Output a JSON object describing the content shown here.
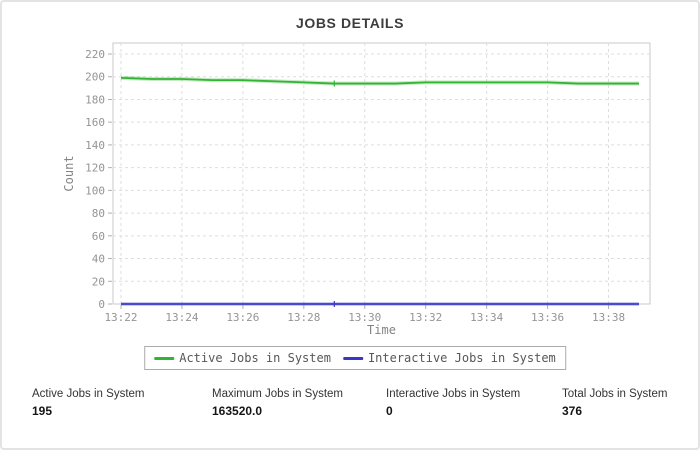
{
  "chart_data": {
    "type": "line",
    "title": "JOBS DETAILS",
    "xlabel": "Time",
    "ylabel": "Count",
    "x": [
      "13:22",
      "13:23",
      "13:24",
      "13:25",
      "13:26",
      "13:27",
      "13:28",
      "13:29",
      "13:30",
      "13:31",
      "13:32",
      "13:33",
      "13:34",
      "13:35",
      "13:36",
      "13:37",
      "13:38",
      "13:39"
    ],
    "x_tick_labels": [
      "13:22",
      "13:24",
      "13:26",
      "13:28",
      "13:30",
      "13:32",
      "13:34",
      "13:36",
      "13:38"
    ],
    "y_ticks": [
      0,
      20,
      40,
      60,
      80,
      100,
      120,
      140,
      160,
      180,
      200,
      220
    ],
    "ylim": [
      0,
      230
    ],
    "grid": true,
    "legend_position": "bottom",
    "marker_index": 7,
    "series": [
      {
        "name": "Active Jobs in System",
        "color": "#32b432",
        "values": [
          199,
          198,
          198,
          197,
          197,
          196,
          195,
          194,
          194,
          194,
          195,
          195,
          195,
          195,
          195,
          194,
          194,
          194
        ]
      },
      {
        "name": "Interactive Jobs in System",
        "color": "#3838c8",
        "values": [
          0,
          0,
          0,
          0,
          0,
          0,
          0,
          0,
          0,
          0,
          0,
          0,
          0,
          0,
          0,
          0,
          0,
          0
        ]
      }
    ]
  },
  "stats": [
    {
      "label": "Active Jobs in System",
      "value": "195"
    },
    {
      "label": "Maximum Jobs in System",
      "value": "163520.0"
    },
    {
      "label": "Interactive Jobs in System",
      "value": "0"
    },
    {
      "label": "Total Jobs in System",
      "value": "376"
    }
  ],
  "colors": {
    "grid": "#dedede",
    "plot_border": "#c8c8c8",
    "tick_mark": "#b0b0b0",
    "legend_border": "#ababab"
  }
}
